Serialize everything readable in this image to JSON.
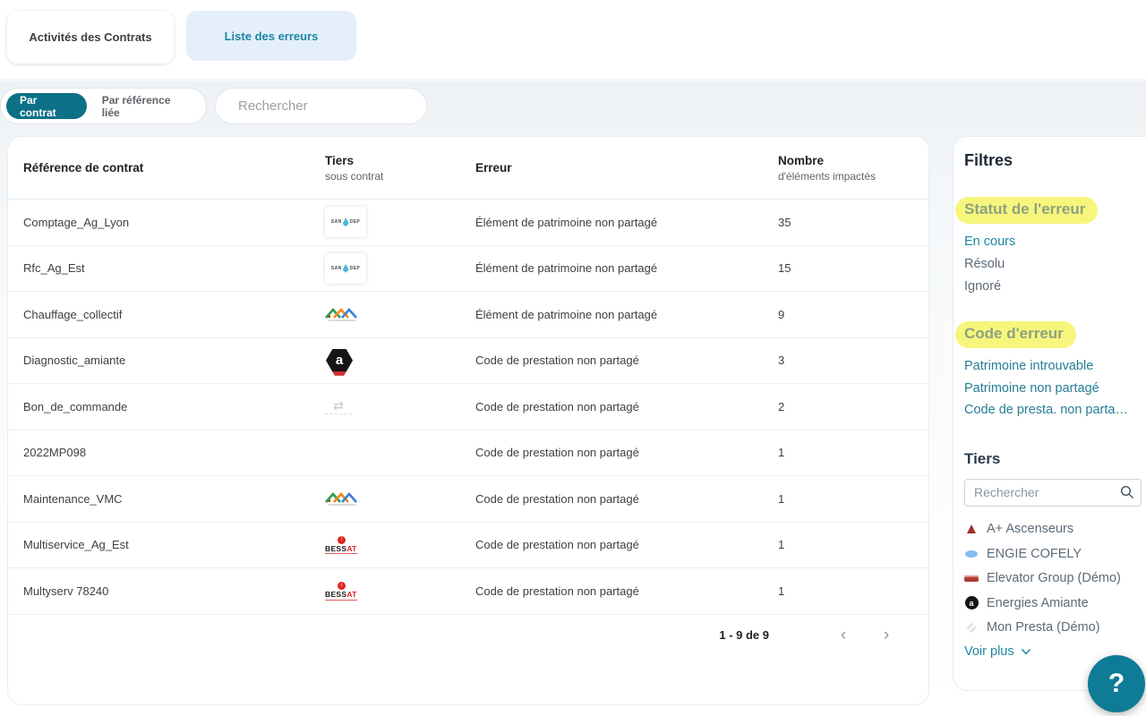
{
  "tabs": [
    {
      "label": "Activités des Contrats",
      "active": false
    },
    {
      "label": "Liste des erreurs",
      "active": true
    }
  ],
  "filter_bar": {
    "toggles": [
      {
        "label": "Par contrat",
        "active": true
      },
      {
        "label": "Par référence liée",
        "active": false
      }
    ],
    "search_placeholder": "Rechercher"
  },
  "table": {
    "columns": {
      "reference": {
        "title": "Référence de contrat",
        "subtitle": ""
      },
      "tiers": {
        "title": "Tiers",
        "subtitle": "sous contrat"
      },
      "error": {
        "title": "Erreur",
        "subtitle": ""
      },
      "count": {
        "title": "Nombre",
        "subtitle": "d'éléments impactés"
      }
    },
    "rows": [
      {
        "reference": "Comptage_Ag_Lyon",
        "logo": "sandep-logo",
        "error": "Élément de patrimoine non partagé",
        "count": "35"
      },
      {
        "reference": "Rfc_Ag_Est",
        "logo": "sandep-logo",
        "error": "Élément de patrimoine non partagé",
        "count": "15"
      },
      {
        "reference": "Chauffage_collectif",
        "logo": "roofs-logo",
        "error": "Élément de patrimoine non partagé",
        "count": "9"
      },
      {
        "reference": "Diagnostic_amiante",
        "logo": "amiante-hex-logo",
        "error": "Code de prestation non partagé",
        "count": "3"
      },
      {
        "reference": "Bon_de_commande",
        "logo": "faint-arrows-logo",
        "error": "Code de prestation non partagé",
        "count": "2"
      },
      {
        "reference": "2022MP098",
        "logo": "",
        "error": "Code de prestation non partagé",
        "count": "1"
      },
      {
        "reference": "Maintenance_VMC",
        "logo": "roofs-logo",
        "error": "Code de prestation non partagé",
        "count": "1"
      },
      {
        "reference": "Multiservice_Ag_Est",
        "logo": "bessat-logo",
        "error": "Code de prestation non partagé",
        "count": "1"
      },
      {
        "reference": "Multyserv 78240",
        "logo": "bessat-logo",
        "error": "Code de prestation non partagé",
        "count": "1"
      }
    ],
    "pagination": {
      "label": "1 - 9 de 9",
      "prev": "‹",
      "next": "›"
    }
  },
  "filters": {
    "title": "Filtres",
    "status": {
      "title": "Statut de l'erreur",
      "items": [
        {
          "label": "En cours",
          "state": "active"
        },
        {
          "label": "Résolu",
          "state": "normal"
        },
        {
          "label": "Ignoré",
          "state": "normal"
        }
      ]
    },
    "code": {
      "title": "Code d'erreur",
      "items": [
        {
          "label": "Patrimoine introuvable",
          "state": "accent"
        },
        {
          "label": "Patrimoine non partagé",
          "state": "accent"
        },
        {
          "label": "Code de presta. non parta…",
          "state": "accent"
        }
      ]
    },
    "tiers": {
      "title": "Tiers",
      "search_placeholder": "Rechercher",
      "items": [
        {
          "label": "A+ Ascenseurs",
          "icon": "aplus-logo-icon"
        },
        {
          "label": "ENGIE COFELY",
          "icon": "engie-logo-icon"
        },
        {
          "label": "Elevator Group (Démo)",
          "icon": "elevator-logo-icon"
        },
        {
          "label": "Energies Amiante",
          "icon": "amiante-logo-icon"
        },
        {
          "label": "Mon Presta (Démo)",
          "icon": "monpresta-logo-icon"
        }
      ],
      "more_label": "Voir plus"
    }
  },
  "help_button": {
    "label": "?"
  },
  "logo_text": {
    "sandep_left": "SAN",
    "sandep_right": "DEP",
    "amiante_letter": "a",
    "bessat_main": "BESS",
    "bessat_accent": "AT",
    "bessat_dot": "!"
  },
  "colors": {
    "primary_teal": "#0c7187",
    "active_link": "#1b87a5",
    "highlight_yellow": "#f7f67c",
    "highlight_text": "#8da181",
    "tab_active_bg": "#e4effa"
  }
}
